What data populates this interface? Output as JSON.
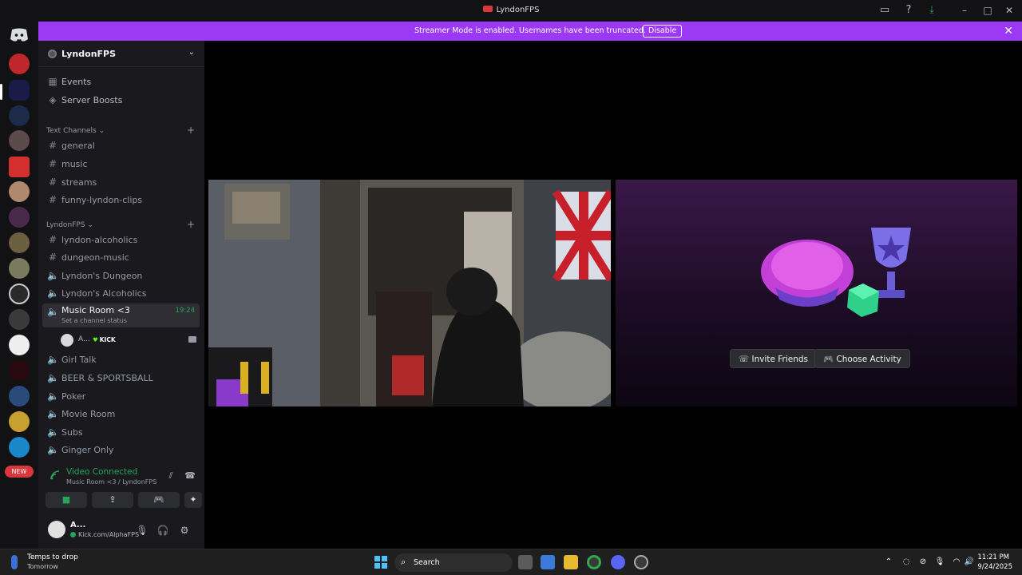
{
  "window": {
    "title": "LyndonFPS"
  },
  "banner": {
    "message": "Streamer Mode is enabled. Usernames have been truncated.",
    "disable_label": "Disable",
    "color": "#9c39f5"
  },
  "server": {
    "name": "LyndonFPS"
  },
  "nav": {
    "events": "Events",
    "boosts": "Server Boosts"
  },
  "categories": {
    "text": "Text Channels",
    "lyndon": "LyndonFPS"
  },
  "text_channels": [
    "general",
    "music",
    "streams",
    "funny-lyndon-clips"
  ],
  "lyndon_channels": [
    "lyndon-alcoholics",
    "dungeon-music"
  ],
  "voice_channels_top": [
    "Lyndon's Dungeon",
    "Lyndon's Alcoholics"
  ],
  "active_voice": {
    "name": "Music Room <3",
    "status": "Set a channel status",
    "timer": "19:24",
    "member_name": "A...",
    "member_badge": "KICK"
  },
  "voice_channels_bottom": [
    "Girl Talk",
    "BEER & SPORTSBALL",
    "Poker",
    "Movie Room",
    "Subs",
    "Ginger Only"
  ],
  "voice_panel": {
    "title": "Video Connected",
    "subtitle": "Music Room <3 / LyndonFPS"
  },
  "user": {
    "name": "A...",
    "status": "Kick.com/AlphaFPS"
  },
  "rail": {
    "new_label": "NEW"
  },
  "activity": {
    "invite_label": "Invite Friends",
    "choose_label": "Choose Activity"
  },
  "taskbar": {
    "weather_title": "Temps to drop",
    "weather_sub": "Tomorrow",
    "search_label": "Search",
    "time": "11:21 PM",
    "date": "9/24/2025"
  },
  "colors": {
    "accent_green": "#23a55a",
    "sidebar": "#1a1a1e",
    "rail": "#121214"
  }
}
